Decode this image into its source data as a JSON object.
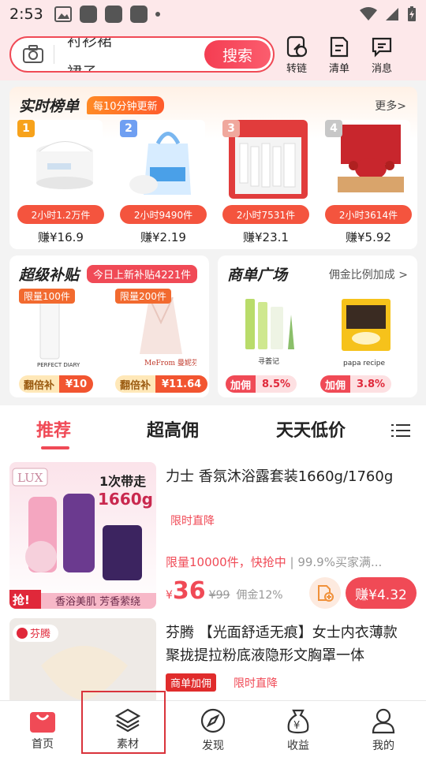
{
  "status": {
    "time": "2:53"
  },
  "search": {
    "rolling_top": "衬衫裙",
    "rolling_bottom": "裙子",
    "button": "搜索"
  },
  "header_actions": [
    {
      "label": "转链",
      "icon": "link-icon"
    },
    {
      "label": "清单",
      "icon": "list-icon"
    },
    {
      "label": "消息",
      "icon": "message-icon"
    }
  ],
  "ranking": {
    "title": "实时榜单",
    "badge": "每10分钟更新",
    "more": "更多>",
    "items": [
      {
        "rank": "1",
        "tag": "2小时1.2万件",
        "price": "赚¥16.9",
        "rank_color": "#f7a21b"
      },
      {
        "rank": "2",
        "tag": "2小时9490件",
        "price": "赚¥2.19",
        "rank_color": "#6f9ff2"
      },
      {
        "rank": "3",
        "tag": "2小时7531件",
        "price": "赚¥23.1",
        "rank_color": "#f0a89d"
      },
      {
        "rank": "4",
        "tag": "2小时3614件",
        "price": "赚¥5.92",
        "rank_color": "#c7c7c7"
      }
    ]
  },
  "subsidy": {
    "title": "超级补贴",
    "badge": "今日上新补贴4221件",
    "items": [
      {
        "limit": "限量100件",
        "label": "翻倍补",
        "amount": "¥10",
        "brand": "PERFECT DIARY"
      },
      {
        "limit": "限量200件",
        "label": "翻倍补",
        "amount": "¥11.64",
        "brand": "MeFrom 曼妮芬"
      }
    ]
  },
  "shop": {
    "title": "商单广场",
    "more": "佣金比例加成 >",
    "items": [
      {
        "label": "加佣",
        "amount": "8.5%",
        "brand": "寻荟记"
      },
      {
        "label": "加佣",
        "amount": "3.8%",
        "brand": "papa recipe"
      }
    ]
  },
  "tabs": [
    "推荐",
    "超高佣",
    "天天低价"
  ],
  "products": [
    {
      "title": "力士  香氛沐浴露套装1660g/1760g",
      "tag": "限时直降",
      "info": "限量10000件，快抢中",
      "info2": "| 99.9%买家满...",
      "currency": "¥",
      "price": "36",
      "old_price": "¥99",
      "commission": "佣金12%",
      "earn": "赚¥4.32",
      "thumb_brand": "LUX",
      "thumb_text1": "1次带走",
      "thumb_text2": "1660g",
      "thumb_grab": "抢!",
      "thumb_banner": "香浴美肌 芳香萦绕"
    },
    {
      "title": "芬腾  【光面舒适无痕】女士内衣薄款聚拢提拉粉底液隐形文胸罩一体",
      "shop_tag": "商单加佣",
      "tag": "限时直降",
      "thumb_brand": "芬腾"
    }
  ],
  "nav": [
    {
      "label": "首页",
      "icon": "home-bag-icon"
    },
    {
      "label": "素材",
      "icon": "layers-icon"
    },
    {
      "label": "发现",
      "icon": "compass-icon"
    },
    {
      "label": "收益",
      "icon": "money-bag-icon"
    },
    {
      "label": "我的",
      "icon": "user-icon"
    }
  ]
}
